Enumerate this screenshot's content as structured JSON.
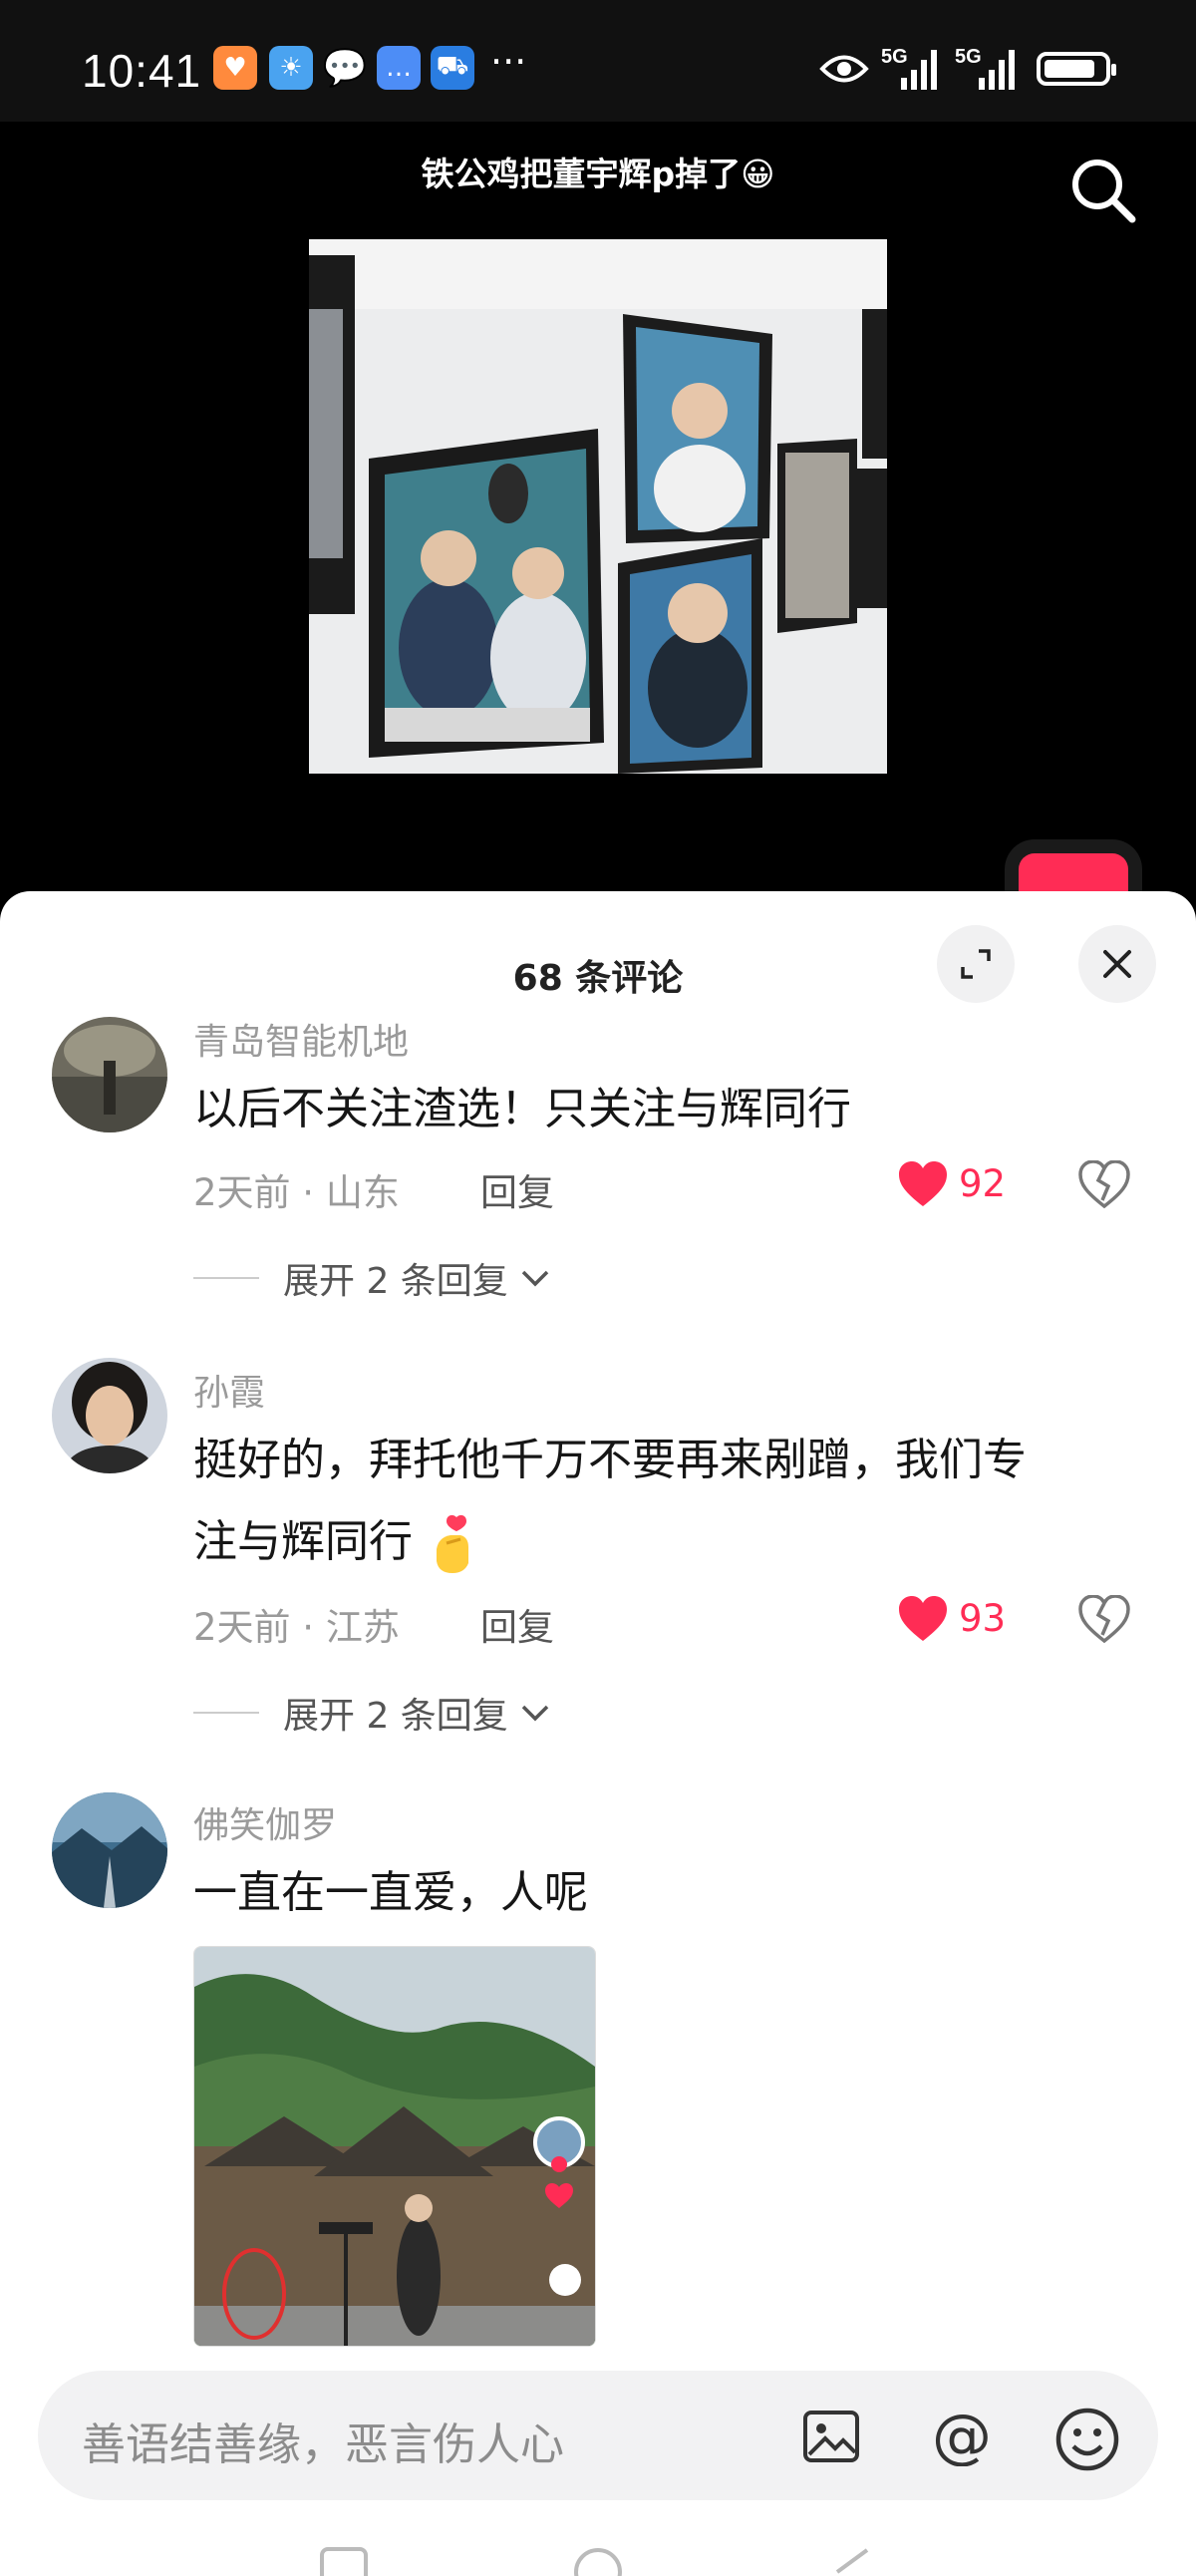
{
  "status_bar": {
    "time": "10:41",
    "more": "···",
    "network_1": "5G",
    "network_2": "5G"
  },
  "video": {
    "title": "铁公鸡把董宇辉p掉了😀"
  },
  "comments_sheet": {
    "title": "68 条评论",
    "comments": [
      {
        "user": "青岛智能机地",
        "text": "以后不关注渣选！只关注与辉同行",
        "time_location": "2天前 · 山东",
        "reply_label": "回复",
        "likes": "92",
        "expand": "展开 2 条回复"
      },
      {
        "user": "孙霞",
        "text_line1": "挺好的，拜托他千万不要再来剐蹭，我们专",
        "text_line2": "注与辉同行",
        "time_location": "2天前 · 江苏",
        "reply_label": "回复",
        "likes": "93",
        "expand": "展开 2 条回复"
      },
      {
        "user": "佛笑伽罗",
        "text": "一直在一直爱，人呢"
      }
    ]
  },
  "input": {
    "placeholder": "善语结善缘，恶言伤人心"
  },
  "colors": {
    "accent": "#ff2c55",
    "muted_text": "#9a9a9a",
    "sheet_bg": "#ffffff"
  }
}
